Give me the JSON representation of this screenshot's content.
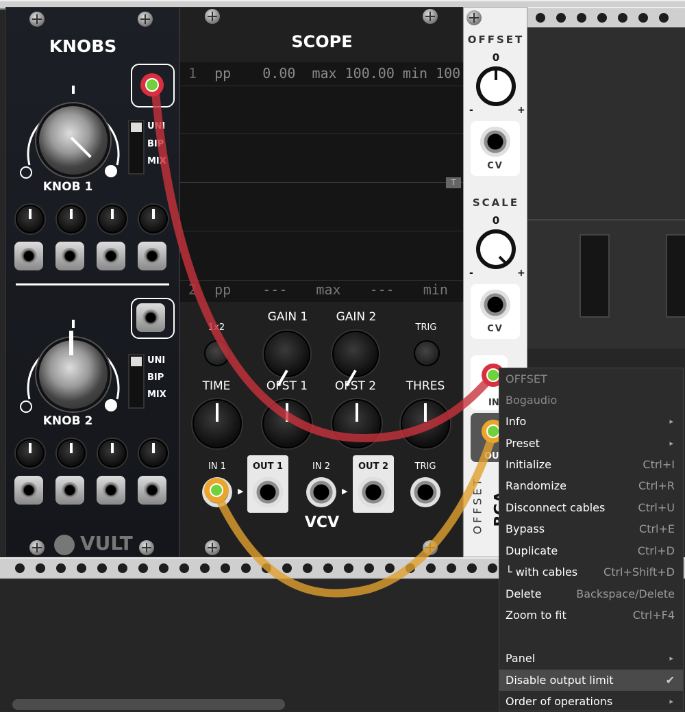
{
  "knobs": {
    "title": "KNOBS",
    "knob1_label": "KNOB 1",
    "knob2_label": "KNOB 2",
    "switch_options": [
      "UNI",
      "BIP",
      "MIX"
    ],
    "brand": "VULT"
  },
  "scope": {
    "title": "SCOPE",
    "ch1": {
      "num": "1",
      "pp_label": "pp",
      "pp": "0.00",
      "max_label": "max",
      "max": "100.00",
      "min_label": "min",
      "min": "100.00"
    },
    "ch2": {
      "num": "2",
      "pp_label": "pp",
      "pp": "---",
      "max_label": "max",
      "max": "---",
      "min_label": "min",
      "min": "---"
    },
    "trigger_marker": "T",
    "labels": {
      "x1x2": "1x2",
      "gain1": "GAIN 1",
      "gain2": "GAIN 2",
      "trig": "TRIG",
      "time": "TIME",
      "ofst1": "OFST 1",
      "ofst2": "OFST 2",
      "thres": "THRES",
      "in1": "IN 1",
      "out1": "OUT 1",
      "in2": "IN 2",
      "out2": "OUT 2",
      "trig_in": "TRIG"
    },
    "logo": "VCV"
  },
  "offset": {
    "offset_label": "OFFSET",
    "scale_label": "SCALE",
    "zero": "0",
    "minus": "-",
    "plus": "+",
    "cv": "CV",
    "side_name": "OFFSET",
    "side_brand": "BGA",
    "in_partial": "IN",
    "out_partial": "OU"
  },
  "context_menu": {
    "header": "OFFSET",
    "brand": "Bogaudio",
    "items": [
      {
        "label": "Info",
        "shortcut": "",
        "submenu": true
      },
      {
        "label": "Preset",
        "shortcut": "",
        "submenu": true
      },
      {
        "label": "Initialize",
        "shortcut": "Ctrl+I"
      },
      {
        "label": "Randomize",
        "shortcut": "Ctrl+R"
      },
      {
        "label": "Disconnect cables",
        "shortcut": "Ctrl+U"
      },
      {
        "label": "Bypass",
        "shortcut": "Ctrl+E"
      },
      {
        "label": "Duplicate",
        "shortcut": "Ctrl+D"
      },
      {
        "label": "└ with cables",
        "shortcut": "Ctrl+Shift+D"
      },
      {
        "label": "Delete",
        "shortcut": "Backspace/Delete"
      },
      {
        "label": "Zoom to fit",
        "shortcut": "Ctrl+F4"
      },
      {
        "label": "Panel",
        "shortcut": "",
        "submenu": true
      },
      {
        "label": "Disable output limit",
        "shortcut": "✔",
        "highlighted": true
      },
      {
        "label": "Order of operations",
        "shortcut": "",
        "submenu": true
      }
    ],
    "submenu_arrow": "▸"
  },
  "colors": {
    "red_cable": "#c8323c",
    "yellow_cable": "#e0a030",
    "jack_led": "#6fd23c"
  }
}
